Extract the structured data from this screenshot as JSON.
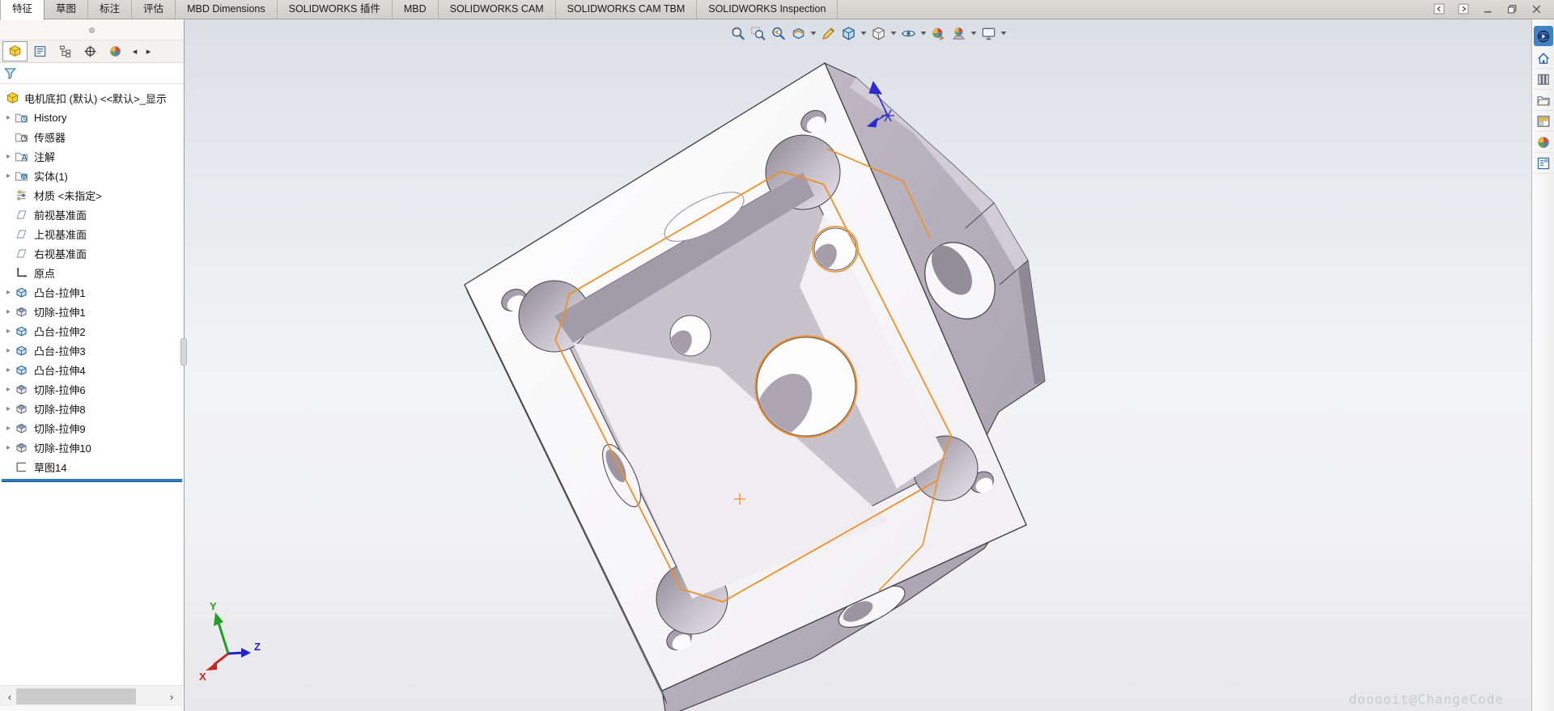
{
  "ribbon": {
    "tabs": [
      {
        "id": "features",
        "label": "特征",
        "active": true
      },
      {
        "id": "sketch",
        "label": "草图",
        "active": false
      },
      {
        "id": "markup",
        "label": "标注",
        "active": false
      },
      {
        "id": "evaluate",
        "label": "评估",
        "active": false
      },
      {
        "id": "mbd-dimensions",
        "label": "MBD Dimensions",
        "active": false
      },
      {
        "id": "solidworks-addins",
        "label": "SOLIDWORKS 插件",
        "active": false
      },
      {
        "id": "mbd",
        "label": "MBD",
        "active": false
      },
      {
        "id": "solidworks-cam",
        "label": "SOLIDWORKS CAM",
        "active": false
      },
      {
        "id": "solidworks-cam-tbm",
        "label": "SOLIDWORKS CAM TBM",
        "active": false
      },
      {
        "id": "solidworks-inspection",
        "label": "SOLIDWORKS Inspection",
        "active": false
      }
    ]
  },
  "window_controls": [
    {
      "id": "previous-document",
      "icon": "boxed-arrow-left"
    },
    {
      "id": "next-document",
      "icon": "boxed-arrow-right"
    },
    {
      "id": "minimize",
      "icon": "minimize"
    },
    {
      "id": "restore",
      "icon": "restore"
    },
    {
      "id": "close",
      "icon": "close"
    }
  ],
  "feature_panel": {
    "tabs": [
      {
        "id": "featuremanager-tree",
        "icon": "part",
        "active": true
      },
      {
        "id": "propertymanager",
        "icon": "property-list",
        "active": false
      },
      {
        "id": "configurationmanager",
        "icon": "configurations",
        "active": false
      },
      {
        "id": "dimxpertmanager",
        "icon": "dimxpert-target",
        "active": false
      },
      {
        "id": "displaymanager",
        "icon": "display-sphere",
        "active": false
      }
    ],
    "nav_left": "◂",
    "nav_right": "▸",
    "root_label": "电机底扣 (默认) <<默认>_显示",
    "items": [
      {
        "id": "history",
        "label": "History",
        "icon": "folder-history",
        "expandable": true
      },
      {
        "id": "sensors",
        "label": "传感器",
        "icon": "folder-sensor",
        "expandable": false
      },
      {
        "id": "annotations",
        "label": "注解",
        "icon": "folder-annot",
        "expandable": true
      },
      {
        "id": "solid-bodies",
        "label": "实体(1)",
        "icon": "folder-solid",
        "expandable": true
      },
      {
        "id": "material",
        "label": "材质 <未指定>",
        "icon": "material",
        "expandable": false
      },
      {
        "id": "front-plane",
        "label": "前视基准面",
        "icon": "plane",
        "expandable": false
      },
      {
        "id": "top-plane",
        "label": "上视基准面",
        "icon": "plane",
        "expandable": false
      },
      {
        "id": "right-plane",
        "label": "右视基准面",
        "icon": "plane",
        "expandable": false
      },
      {
        "id": "origin",
        "label": "原点",
        "icon": "origin",
        "expandable": false
      },
      {
        "id": "boss-extrude1",
        "label": "凸台-拉伸1",
        "icon": "boss",
        "expandable": true
      },
      {
        "id": "cut-extrude1",
        "label": "切除-拉伸1",
        "icon": "cut",
        "expandable": true
      },
      {
        "id": "boss-extrude2",
        "label": "凸台-拉伸2",
        "icon": "boss",
        "expandable": true
      },
      {
        "id": "boss-extrude3",
        "label": "凸台-拉伸3",
        "icon": "boss",
        "expandable": true
      },
      {
        "id": "boss-extrude4",
        "label": "凸台-拉伸4",
        "icon": "boss",
        "expandable": true
      },
      {
        "id": "cut-extrude6",
        "label": "切除-拉伸6",
        "icon": "cut",
        "expandable": true
      },
      {
        "id": "cut-extrude8",
        "label": "切除-拉伸8",
        "icon": "cut",
        "expandable": true
      },
      {
        "id": "cut-extrude9",
        "label": "切除-拉伸9",
        "icon": "cut",
        "expandable": true
      },
      {
        "id": "cut-extrude10",
        "label": "切除-拉伸10",
        "icon": "cut",
        "expandable": true
      },
      {
        "id": "sketch14",
        "label": "草图14",
        "icon": "sketch",
        "expandable": false
      }
    ]
  },
  "headsup": {
    "icons": [
      {
        "id": "zoom-to-fit",
        "caret": false
      },
      {
        "id": "zoom-to-area",
        "caret": false
      },
      {
        "id": "previous-view",
        "caret": false
      },
      {
        "id": "section-view",
        "caret": true
      },
      {
        "id": "dynamic-annotation-views",
        "caret": false
      },
      {
        "id": "view-orientation",
        "caret": true
      },
      {
        "id": "display-style",
        "caret": true
      },
      {
        "id": "hide-show-items",
        "caret": true
      },
      {
        "id": "edit-appearance",
        "caret": false
      },
      {
        "id": "apply-scene",
        "caret": true
      },
      {
        "id": "view-settings",
        "caret": true
      }
    ]
  },
  "taskpane": {
    "icons": [
      {
        "id": "globe",
        "active": true
      },
      {
        "id": "home",
        "active": false
      },
      {
        "id": "design-library",
        "active": false
      },
      {
        "id": "file-explorer",
        "active": false
      },
      {
        "id": "view-palette",
        "active": false
      },
      {
        "id": "appearances-scenes",
        "active": false
      },
      {
        "id": "custom-properties",
        "active": false
      }
    ]
  },
  "viewport": {
    "watermark": "dooooit@ChangeCode",
    "triad": {
      "x": "X",
      "y": "Y",
      "z": "Z"
    }
  },
  "colors": {
    "sketch_orange": "#ef8f25",
    "rollback_blue": "#2b7bbf",
    "taskpane_active": "#3f83c4",
    "axis_x": "#cc2222",
    "axis_y": "#22a022",
    "axis_z": "#2222cc"
  }
}
